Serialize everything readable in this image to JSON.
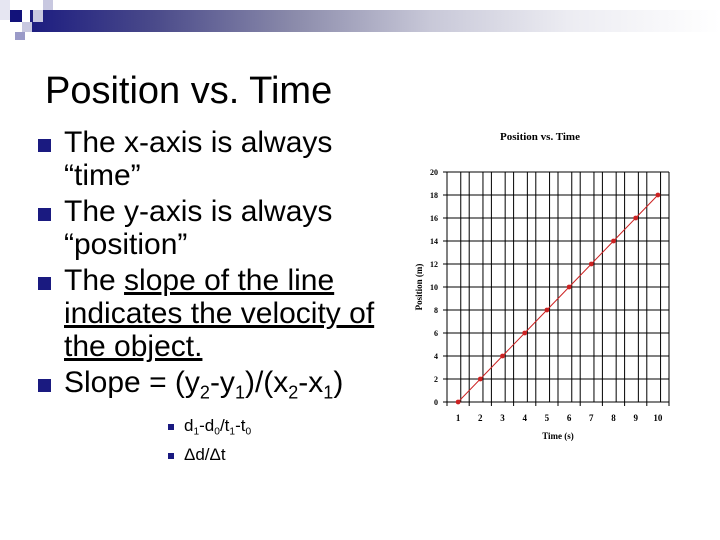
{
  "slide": {
    "title": "Position vs. Time",
    "bullets": [
      {
        "text": "The x-axis is always “time”"
      },
      {
        "text": "The y-axis is always “position”"
      },
      {
        "pre": "The ",
        "underlined": "slope of the line indicates the velocity of the object."
      },
      {
        "text_parts": [
          "Slope = (y",
          "2",
          "-y",
          "1",
          ")/(x",
          "2",
          "-x",
          "1",
          ")"
        ]
      }
    ],
    "sub_bullets": [
      {
        "text_parts": [
          "d",
          "1",
          "-d",
          "0",
          "/t",
          "1",
          "-t",
          "0"
        ]
      },
      {
        "text": "Δd/Δt"
      }
    ],
    "colors": {
      "bullet": "#1a1a80",
      "series": "#cc2222"
    }
  },
  "chart_data": {
    "type": "line",
    "title": "Position vs. Time",
    "xlabel": "Time (s)",
    "ylabel": "Position (m)",
    "categories": [
      "1",
      "2",
      "3",
      "4",
      "5",
      "6",
      "7",
      "8",
      "9",
      "10"
    ],
    "series": [
      {
        "name": "Position",
        "values": [
          0,
          2,
          4,
          6,
          8,
          10,
          12,
          14,
          16,
          18
        ]
      }
    ],
    "ylim": [
      0,
      20
    ],
    "yticks": [
      0,
      2,
      4,
      6,
      8,
      10,
      12,
      14,
      16,
      18,
      20
    ],
    "grid": true,
    "legend": "none"
  }
}
